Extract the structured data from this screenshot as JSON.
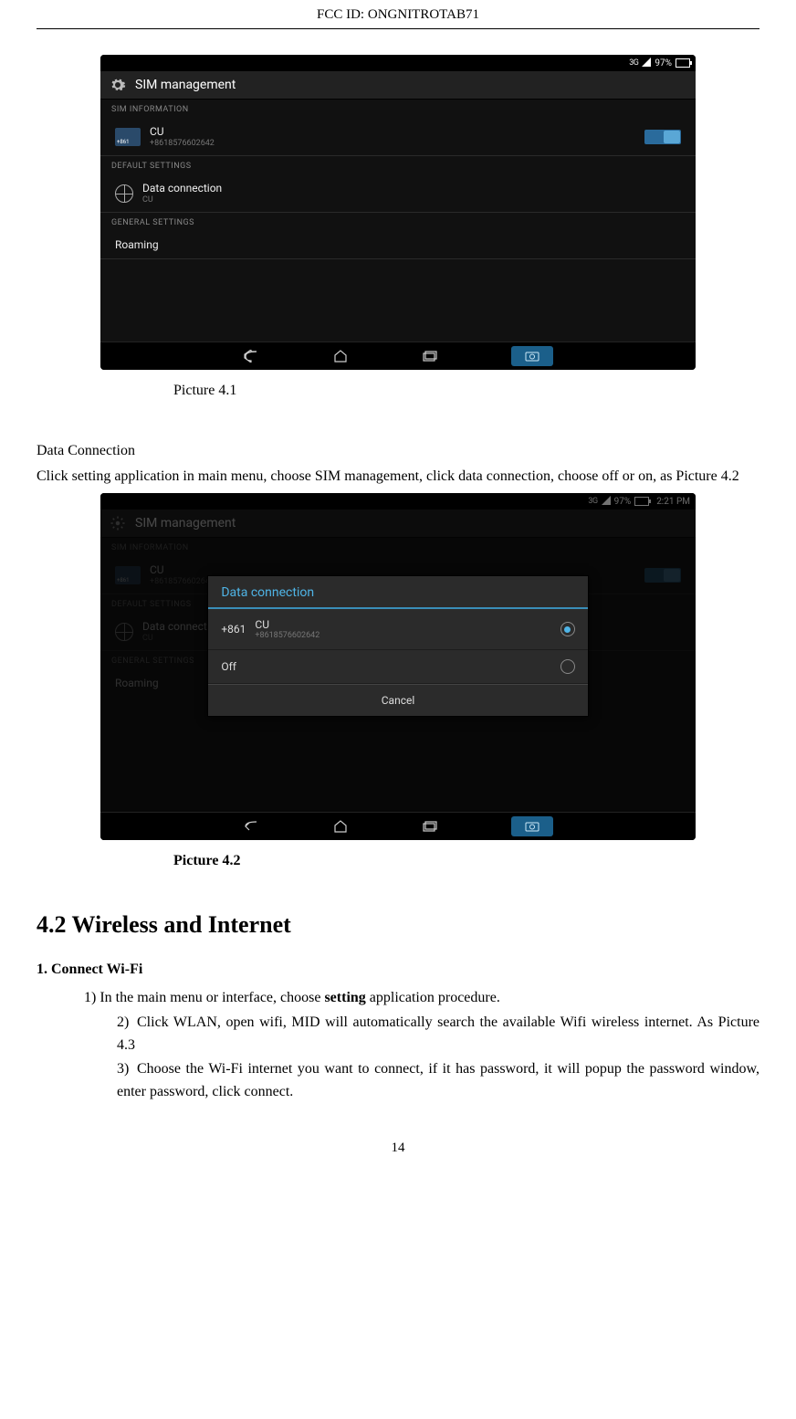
{
  "header": {
    "fcc_label": "FCC ID:",
    "fcc_id": "ONGNITROTAB71"
  },
  "shot1": {
    "status": {
      "net": "3G",
      "signal_icon": "signal",
      "batt_pct": "97%",
      "batt_icon": "battery"
    },
    "titlebar": {
      "icon": "gear-icon",
      "title": "SIM management"
    },
    "section_sim_info": "SIM INFORMATION",
    "sim_row": {
      "chip_prefix": "+861",
      "name": "CU",
      "number": "+8618576602642",
      "toggle_on": true
    },
    "section_default": "DEFAULT SETTINGS",
    "data_row": {
      "title": "Data connection",
      "sub": "CU"
    },
    "section_general": "GENERAL SETTINGS",
    "roaming_row": {
      "title": "Roaming"
    },
    "nav": {
      "back": "back-icon",
      "home": "home-icon",
      "recent": "recent-icon",
      "capture": "capture-icon"
    },
    "caption": "Picture 4.1"
  },
  "body1": {
    "heading": "Data Connection",
    "para": "Click setting application in main menu, choose SIM management, click data connection, choose off or on, as Picture 4.2"
  },
  "shot2": {
    "status": {
      "net": "3G",
      "batt_pct": "97%",
      "time": "2:21 PM"
    },
    "titlebar_title": "SIM management",
    "dialog": {
      "title": "Data connection",
      "opt1": {
        "chip_prefix": "+861",
        "name": "CU",
        "number": "+8618576602642",
        "selected": true
      },
      "opt2": {
        "label": "Off",
        "selected": false
      },
      "cancel": "Cancel"
    },
    "caption": "Picture 4.2"
  },
  "section42": {
    "title": "4.2 Wireless and Internet",
    "subhead": "1. Connect Wi-Fi",
    "item1_pre": "1) In the main menu or interface, choose ",
    "item1_bold": "setting",
    "item1_post": " application procedure.",
    "item2_num": "2)",
    "item2_text": "Click WLAN, open wifi, MID will automatically search the available Wifi wireless internet. As Picture 4.3",
    "item3_num": "3)",
    "item3_text": "Choose the Wi-Fi internet you want to connect, if it has password, it will popup the password window, enter password, click connect."
  },
  "page_number": "14"
}
